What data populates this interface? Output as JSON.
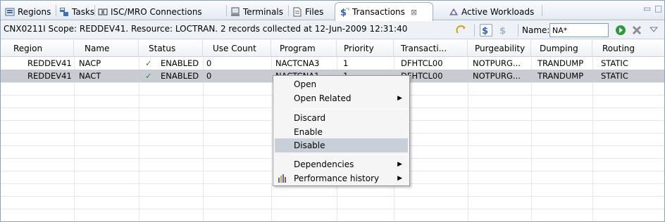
{
  "tabs": [
    {
      "label": "Regions",
      "icon": "regions-icon"
    },
    {
      "label": "Tasks",
      "icon": "tasks-icon"
    },
    {
      "label": "ISC/MRO Connections",
      "icon": "connections-icon"
    },
    {
      "label": "Terminals",
      "icon": "terminals-icon"
    },
    {
      "label": "Files",
      "icon": "files-icon"
    },
    {
      "label": "Transactions",
      "icon": "transactions-icon",
      "active": true,
      "close": "⊠"
    },
    {
      "label": "Active Workloads",
      "icon": "workloads-icon"
    }
  ],
  "window_controls": {
    "minimize": "▭",
    "maximize": "□"
  },
  "info": {
    "status_text": "CNX0211I Scope: REDDEV41. Resource: LOCTRAN. 2 records collected at 12-Jun-2009 12:31:40",
    "name_label": "Name:",
    "name_value": "NA*"
  },
  "table": {
    "columns": [
      "Region",
      "Name",
      "Status",
      "Use Count",
      "Program",
      "Priority",
      "Transacti...",
      "Purgeability",
      "Dumping",
      "Routing"
    ],
    "rows": [
      {
        "region": "REDDEV41",
        "name": "NACP",
        "status_mark": "✓",
        "status": "ENABLED",
        "use_count": "0",
        "program": "NACTCNA3",
        "priority": "1",
        "transaction": "DFHTCL00",
        "purgeability": "NOTPURG...",
        "dumping": "TRANDUMP",
        "routing": "STATIC"
      },
      {
        "region": "REDDEV41",
        "name": "NACT",
        "status_mark": "✓",
        "status": "ENABLED",
        "use_count": "0",
        "program": "NACTCNA1",
        "priority": "1",
        "transaction": "DFHTCL00",
        "purgeability": "NOTPURG...",
        "dumping": "TRANDUMP",
        "routing": "STATIC",
        "selected": true
      }
    ]
  },
  "context_menu": {
    "items": [
      "Open",
      "Open Related",
      "Discard",
      "Enable",
      "Disable",
      "Dependencies",
      "Performance history"
    ],
    "highlighted": "Disable",
    "submenu_arrow": "▶"
  },
  "colors": {
    "accent_green": "#2d8a2d",
    "selection": "#c8ccd2",
    "menu_hover": "#c9cfd8"
  }
}
